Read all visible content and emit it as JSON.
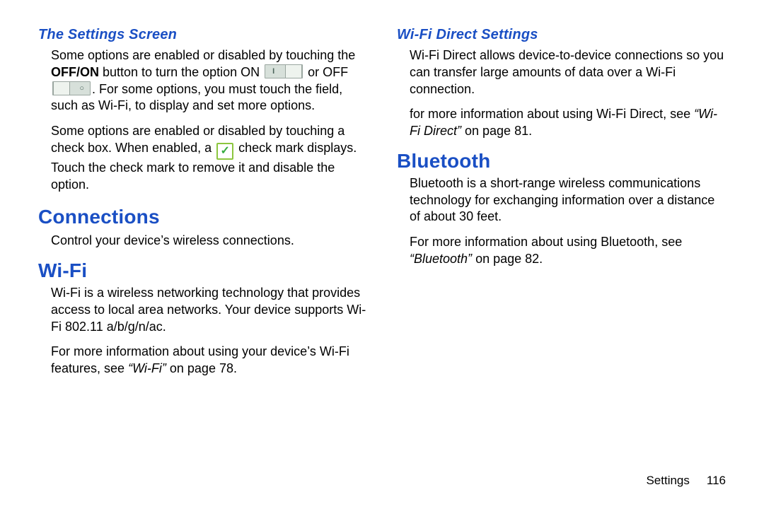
{
  "left": {
    "settingsScreenHeading": "The Settings Screen",
    "p1a": "Some options are enabled or disabled by touching the ",
    "p1b_bold": "OFF/ON",
    "p1c": " button to turn the option ON ",
    "p1d": " or OFF ",
    "p1e": ". For some options, you must touch the field, such as Wi-Fi, to display and set more options.",
    "p2a": "Some options are enabled or disabled by touching a check box. When enabled, a ",
    "p2b": " check mark displays. Touch the check mark to remove it and disable the option.",
    "connectionsHeading": "Connections",
    "connectionsPara": "Control your device’s wireless connections.",
    "wifiHeading": "Wi-Fi",
    "wifiP1": "Wi-Fi is a wireless networking technology that provides access to local area networks. Your device supports Wi-Fi 802.11 a/b/g/n/ac.",
    "wifiP2a": "For more information about using your device’s Wi-Fi features, see ",
    "wifiP2b_ital": "“Wi-Fi”",
    "wifiP2c": " on page 78."
  },
  "right": {
    "wfdHeading": "Wi-Fi Direct Settings",
    "wfdP1": "Wi-Fi Direct allows device-to-device connections so you can transfer large amounts of data over a Wi-Fi connection.",
    "wfdP2a": "for more information about using Wi-Fi Direct, see ",
    "wfdP2b_ital": "“Wi-Fi Direct”",
    "wfdP2c": " on page 81.",
    "btHeading": "Bluetooth",
    "btP1": "Bluetooth is a short-range wireless communications technology for exchanging information over a distance of about 30 feet.",
    "btP2a": "For more information about using Bluetooth, see ",
    "btP2b_ital": "“Bluetooth”",
    "btP2c": " on page 82."
  },
  "footer": {
    "section": "Settings",
    "page": "116"
  }
}
